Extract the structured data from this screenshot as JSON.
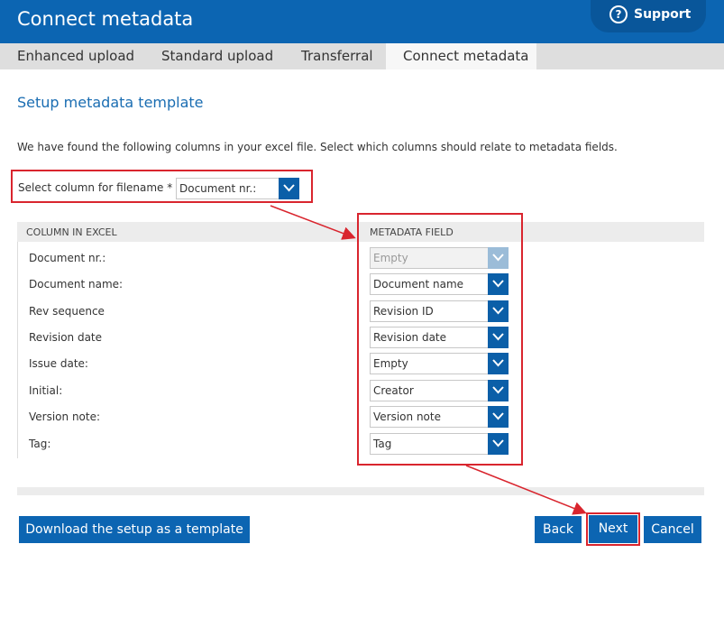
{
  "header": {
    "title": "Connect metadata",
    "support_label": "Support"
  },
  "tabs": [
    {
      "label": "Enhanced upload"
    },
    {
      "label": "Standard upload"
    },
    {
      "label": "Transferral"
    },
    {
      "label": "Connect metadata",
      "active": true
    }
  ],
  "section_title": "Setup metadata template",
  "intro": "We have found the following columns in your excel file. Select which columns should relate to metadata fields.",
  "filename": {
    "label": "Select column for filename *",
    "value": "Document nr.:"
  },
  "table": {
    "col_excel": "COLUMN IN EXCEL",
    "col_meta": "METADATA FIELD",
    "rows": [
      {
        "column": "Document nr.:",
        "field": "Empty",
        "disabled": true
      },
      {
        "column": "Document name:",
        "field": "Document name"
      },
      {
        "column": "Rev sequence",
        "field": "Revision ID"
      },
      {
        "column": "Revision date",
        "field": "Revision date"
      },
      {
        "column": "Issue date:",
        "field": "Empty"
      },
      {
        "column": "Initial:",
        "field": "Creator"
      },
      {
        "column": "Version note:",
        "field": "Version note"
      },
      {
        "column": "Tag:",
        "field": "Tag"
      }
    ]
  },
  "buttons": {
    "download": "Download the setup as a template",
    "back": "Back",
    "next": "Next",
    "cancel": "Cancel"
  },
  "colors": {
    "header": "#0c65b2",
    "highlight": "#d9252e",
    "accent": "#1a6db2"
  }
}
